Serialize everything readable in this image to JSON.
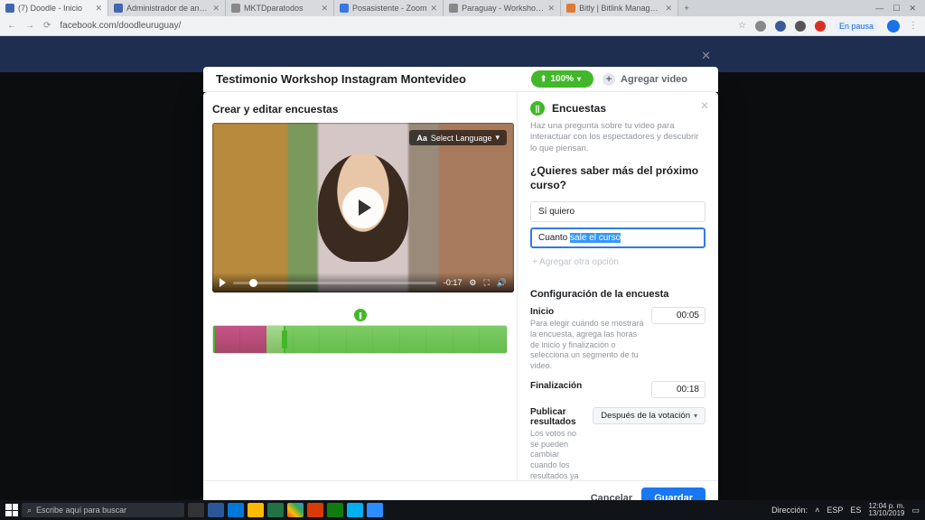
{
  "browser": {
    "tabs": [
      {
        "label": "(7) Doodle - Inicio",
        "active": true,
        "fav": "fb"
      },
      {
        "label": "Administrador de anuncios - Act",
        "fav": "fb"
      },
      {
        "label": "MKTDparatodos",
        "fav": "gray"
      },
      {
        "label": "Posasistente - Zoom",
        "fav": "blue"
      },
      {
        "label": "Paraguay - Workshop Doodle",
        "fav": "gray"
      },
      {
        "label": "Bitly | Bitlink Management",
        "fav": "orange"
      }
    ],
    "url": "facebook.com/doodleuruguay/",
    "pause": "En pausa"
  },
  "header": {
    "title": "Testimonio Workshop Instagram Montevideo",
    "upload_pct": "100%",
    "add_video": "Agregar video"
  },
  "left": {
    "title": "Crear y editar encuestas",
    "lang_select": "Select Language",
    "time": "-0:17"
  },
  "right": {
    "title": "Encuestas",
    "help": "Haz una pregunta sobre tu video para interactuar con los espectadores y descubrir lo que piensan.",
    "question": "¿Quieres saber más del próximo curso?",
    "option1": "Sí quiero",
    "option2_pre": "Cuanto ",
    "option2_sel": "sale el curso",
    "add_option": "+ Agregar otra opción",
    "config_title": "Configuración de la encuesta",
    "start_label": "Inicio",
    "start_hint": "Para elegir cuándo se mostrará la encuesta, agrega las horas de inicio y finalización o selecciona un segmento de tu video.",
    "start_val": "00:05",
    "end_label": "Finalización",
    "end_val": "00:18",
    "pub_label": "Publicar resultados",
    "pub_hint": "Los votos no se pueden cambiar cuando los resultados ya se publicaron.",
    "pub_val": "Después de la votación"
  },
  "footer": {
    "cancel": "Cancelar",
    "save": "Guardar"
  },
  "taskbar": {
    "search_ph": "Escribe aquí para buscar",
    "direction": "Dirección:",
    "lang": "ESP",
    "kbd": "ES",
    "time": "12:04 p. m.",
    "date": "13/10/2019"
  }
}
